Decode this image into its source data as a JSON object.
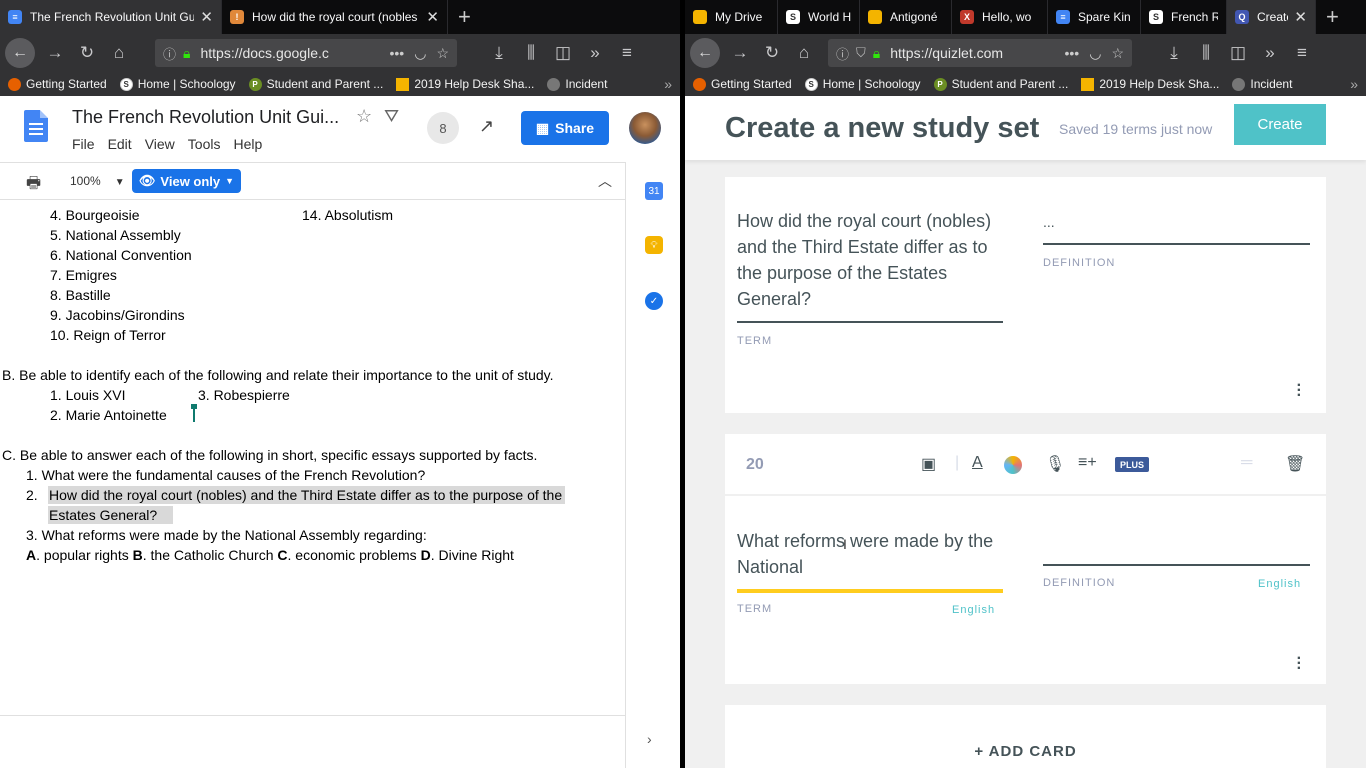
{
  "left_browser": {
    "tabs": [
      {
        "title": "The French Revolution Unit Guid",
        "active": true
      },
      {
        "title": "How did the royal court (nobles",
        "active": false
      }
    ],
    "url": "https://docs.google.c",
    "bookmarks": [
      "Getting Started",
      "Home | Schoology",
      "Student and Parent ...",
      "2019 Help Desk Sha...",
      "Incident"
    ]
  },
  "docs": {
    "title": "The French Revolution Unit Gui...",
    "menu": [
      "File",
      "Edit",
      "View",
      "Tools",
      "Help"
    ],
    "collaborators": "8",
    "share_label": "Share",
    "zoom": "100%",
    "mode_label": "View only",
    "list_a_left": [
      "4.  Bourgeoisie",
      "5.  National Assembly",
      "6.  National Convention",
      "7.   Emigres",
      "8.  Bastille",
      "9. Jacobins/Girondins",
      "10.  Reign of Terror"
    ],
    "list_a_right": "14. Absolutism",
    "section_b": "B.  Be able to identify each of the following and relate their importance to the unit of study.",
    "section_b_items": [
      "1.  Louis XVI",
      "3.  Robespierre",
      "2.  Marie Antoinette"
    ],
    "section_c": "C.  Be able to answer each of the following in short, specific essays supported by facts.",
    "q1": "1.   What were the fundamental causes of the French Revolution?",
    "q2_num": "2.",
    "q2_line1": "How did the royal court (nobles) and the Third Estate differ as to the purpose of the",
    "q2_line2": "Estates General?",
    "q3": "3.   What reforms were made by the National Assembly regarding:",
    "q3_parts": [
      {
        "letter": "A",
        "text": ". popular rights "
      },
      {
        "letter": "B",
        "text": ". the Catholic Church "
      },
      {
        "letter": "C",
        "text": ". economic problems "
      },
      {
        "letter": "D",
        "text": ". Divine Right"
      }
    ]
  },
  "right_browser": {
    "tabs": [
      {
        "title": "My Drive",
        "active": false
      },
      {
        "title": "World His",
        "active": false
      },
      {
        "title": "Antigoné",
        "active": false
      },
      {
        "title": "Hello, wo",
        "active": false
      },
      {
        "title": "Spare Kin",
        "active": false
      },
      {
        "title": "French Re",
        "active": false
      },
      {
        "title": "Create",
        "active": true
      }
    ],
    "url": "https://quizlet.com",
    "bookmarks": [
      "Getting Started",
      "Home | Schoology",
      "Student and Parent ...",
      "2019 Help Desk Sha...",
      "Incident"
    ]
  },
  "quizlet": {
    "page_title": "Create a new study set",
    "save_status": "Saved 19 terms just now",
    "create_label": "Create",
    "card19": {
      "term_lines": [
        "How did the royal court (nobles)",
        "and the Third Estate differ as to",
        "the purpose of the Estates",
        "General?"
      ],
      "definition": "...",
      "term_label": "TERM",
      "definition_label": "DEFINITION"
    },
    "card20": {
      "number": "20",
      "plus_label": "PLUS",
      "term_lines": [
        "What reforms were made by the",
        "National"
      ],
      "term_label": "TERM",
      "definition_label": "DEFINITION",
      "language": "English"
    },
    "add_card_label": "+ ADD CARD"
  },
  "colors": {
    "docs_blue": "#1a73e8",
    "quizlet_teal": "#4fc2c8",
    "quizlet_slate": "#455358",
    "quizlet_yellow": "#ffcd1f"
  }
}
